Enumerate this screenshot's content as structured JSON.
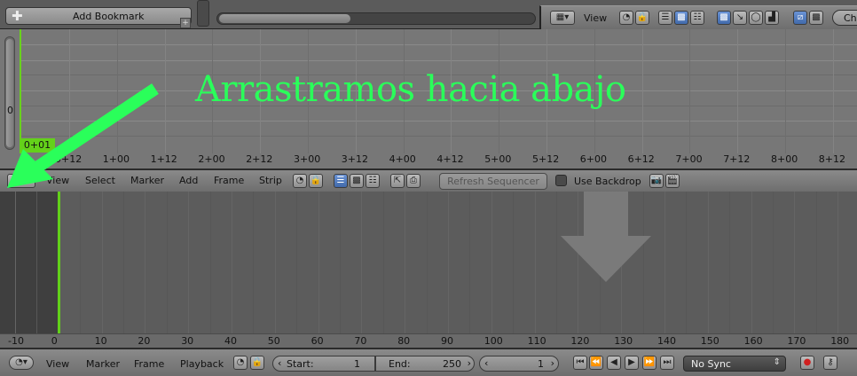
{
  "top_bar": {
    "bookmark_label": "Add Bookmark",
    "view_label": "View",
    "cut_label": "Ch"
  },
  "graph": {
    "y_label": "0",
    "frame_badge": "0+01",
    "ticks": [
      "0+12",
      "1+00",
      "1+12",
      "2+00",
      "2+12",
      "3+00",
      "3+12",
      "4+00",
      "4+12",
      "5+00",
      "5+12",
      "6+00",
      "6+12",
      "7+00",
      "7+12",
      "8+00",
      "8+12"
    ]
  },
  "annotation": {
    "text": "Arrastramos hacia abajo",
    "color": "#2aff5a"
  },
  "sequencer_header": {
    "menu": [
      "View",
      "Select",
      "Marker",
      "Add",
      "Frame",
      "Strip"
    ],
    "refresh_label": "Refresh Sequencer",
    "backdrop_label": "Use Backdrop",
    "backdrop_checked": false
  },
  "timeline": {
    "ticks": [
      "-10",
      "0",
      "10",
      "20",
      "30",
      "40",
      "50",
      "60",
      "70",
      "80",
      "90",
      "100",
      "110",
      "120",
      "130",
      "140",
      "150",
      "160",
      "170",
      "180"
    ],
    "current_frame_color": "#62d11a"
  },
  "footer": {
    "menu": [
      "View",
      "Marker",
      "Frame",
      "Playback"
    ],
    "start_label": "Start:",
    "start_value": "1",
    "end_label": "End:",
    "end_value": "250",
    "current_frame": "1",
    "sync_label": "No Sync"
  }
}
